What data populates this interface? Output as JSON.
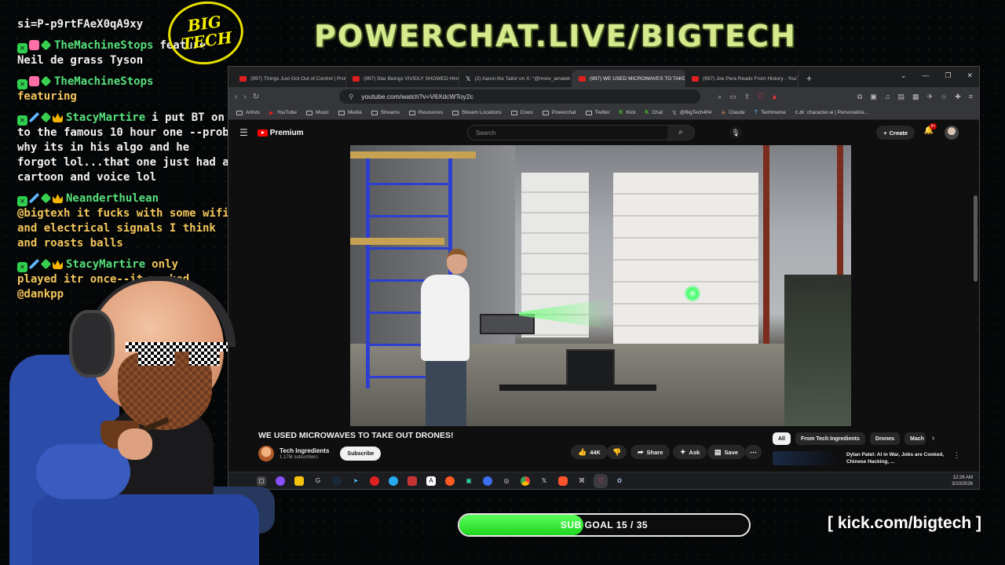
{
  "header": {
    "title": "POWERCHAT.LIVE/BIGTECH",
    "logo_line1": "BIG",
    "logo_line2": "TECH"
  },
  "chat": {
    "top_line": "si=P-p9rtFAeX0qA9xy",
    "messages": [
      {
        "user": "TheMachineStops",
        "inline": "feature",
        "text": "Neil de grass Tyson",
        "badges": [
          "mod",
          "gift",
          "sub"
        ],
        "color": "white"
      },
      {
        "user": "TheMachineStops",
        "inline": "",
        "text": "featuring",
        "badges": [
          "mod",
          "gift",
          "sub"
        ],
        "color": "yellow"
      },
      {
        "user": "StacyMartire",
        "inline": "i put BT on",
        "text": "to the famous 10 hour one --prob why its in his algo and he forgot lol...that one just had a cartoon and voice lol",
        "badges": [
          "mod",
          "sword",
          "sub",
          "crown"
        ],
        "color": "white"
      },
      {
        "user": "Neanderthulean",
        "inline": "",
        "text": "@bigtexh it fucks with some wifi and electrical signals I think and roasts balls",
        "badges": [
          "mod",
          "sword",
          "sub",
          "crown"
        ],
        "color": "yellow"
      },
      {
        "user": "StacyMartire",
        "inline": "only",
        "text": "played itr once--it worked @dankpp",
        "badges": [
          "mod",
          "sword",
          "sub",
          "crown"
        ],
        "color": "yellow"
      }
    ]
  },
  "browser": {
    "tabs": [
      {
        "label": "(997) Things Just Got Out of Control | Prof Ji",
        "icon": "youtube-icon",
        "active": false
      },
      {
        "label": "(997) Star Beings VIVIDLY SHOWED Him 3 Fu",
        "icon": "youtube-icon",
        "active": false
      },
      {
        "label": "(2) Aaron the Tailor on X: \"@more_amalek Tr",
        "icon": "x-icon",
        "active": false
      },
      {
        "label": "(997) WE USED MICROWAVES TO TAKE",
        "icon": "youtube-icon",
        "active": true
      },
      {
        "label": "(997) Joe Pera Reads From History - YouTube",
        "icon": "youtube-icon",
        "active": false
      }
    ],
    "url": "youtube.com/watch?v=V6XdcWToy2c",
    "bookmarks": [
      {
        "label": "Artists",
        "type": "folder"
      },
      {
        "label": "YouTube",
        "type": "youtube"
      },
      {
        "label": "Music",
        "type": "folder"
      },
      {
        "label": "Media",
        "type": "folder"
      },
      {
        "label": "Streams",
        "type": "folder"
      },
      {
        "label": "Resources",
        "type": "folder"
      },
      {
        "label": "Stream Locations",
        "type": "folder"
      },
      {
        "label": "Cows",
        "type": "folder"
      },
      {
        "label": "Powerchat",
        "type": "folder"
      },
      {
        "label": "Twitter",
        "type": "folder"
      },
      {
        "label": "Kick",
        "type": "kick"
      },
      {
        "label": "Chat",
        "type": "kick"
      },
      {
        "label": "@BigTech404",
        "type": "x"
      },
      {
        "label": "Claude",
        "type": "claude"
      },
      {
        "label": "Techmeme",
        "type": "techmeme"
      },
      {
        "label": "character.ai | Personalize...",
        "type": "cai"
      }
    ]
  },
  "youtube": {
    "logo": "Premium",
    "search_placeholder": "Search",
    "create_label": "Create",
    "notif_count": "9+",
    "video_title": "WE USED MICROWAVES TO TAKE OUT DRONES!",
    "channel_name": "Tech Ingredients",
    "subscribers": "1.17M subscribers",
    "subscribe_label": "Subscribe",
    "like_count": "44K",
    "share_label": "Share",
    "ask_label": "Ask",
    "save_label": "Save",
    "chips": [
      "All",
      "From Tech Ingredients",
      "Drones",
      "Mach"
    ],
    "rec_title": "Dylan Patel: AI in War, Jobs are Cooked, Chinese Hacking, ..."
  },
  "taskbar": {
    "time": "12:26 AM",
    "date": "3/10/2026"
  },
  "overlay": {
    "goal_text": "SUB GOAL 15 / 35",
    "goal_current": 15,
    "goal_target": 35,
    "kick_url": "[ kick.com/bigtech ]"
  },
  "colors": {
    "accent_green": "#53fc18",
    "header_text": "#d7e98d",
    "chat_user": "#57e07c",
    "chat_yellow": "#f4c65c",
    "youtube_red": "#ff0000"
  }
}
